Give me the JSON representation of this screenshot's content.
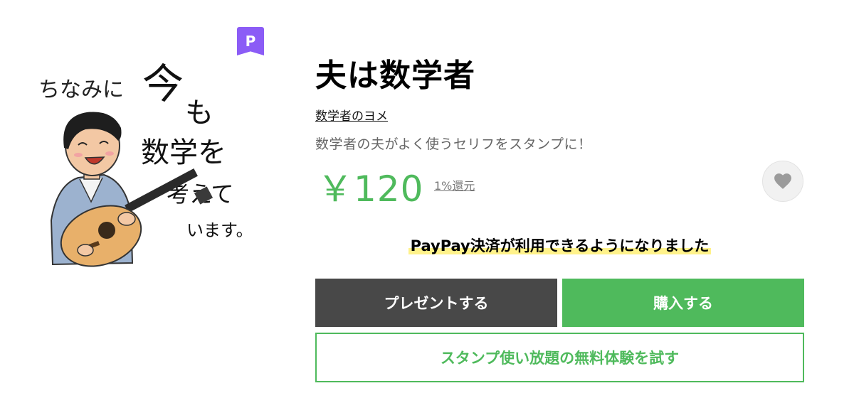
{
  "product": {
    "title": "夫は数学者",
    "author": "数学者のヨメ",
    "description": "数学者の夫がよく使うセリフをスタンプに！",
    "price": "￥120",
    "cashback": "1%還元",
    "premium_badge": "P"
  },
  "sticker": {
    "line1": "ちなみに",
    "big_char": "今",
    "small_char": "も",
    "line2": "数学を",
    "line3": "考えて",
    "line4": "います。"
  },
  "notice": {
    "paypay": "PayPay決済が利用できるようになりました"
  },
  "actions": {
    "gift_label": "プレゼントする",
    "buy_label": "購入する",
    "trial_label": "スタンプ使い放題の無料体験を試す"
  },
  "icons": {
    "favorite": "heart-icon",
    "premium": "premium-badge-icon"
  },
  "colors": {
    "accent_green": "#4fba5c",
    "gift_gray": "#484848",
    "premium_purple": "#8b5cf6",
    "highlight_yellow": "#fff28a"
  }
}
